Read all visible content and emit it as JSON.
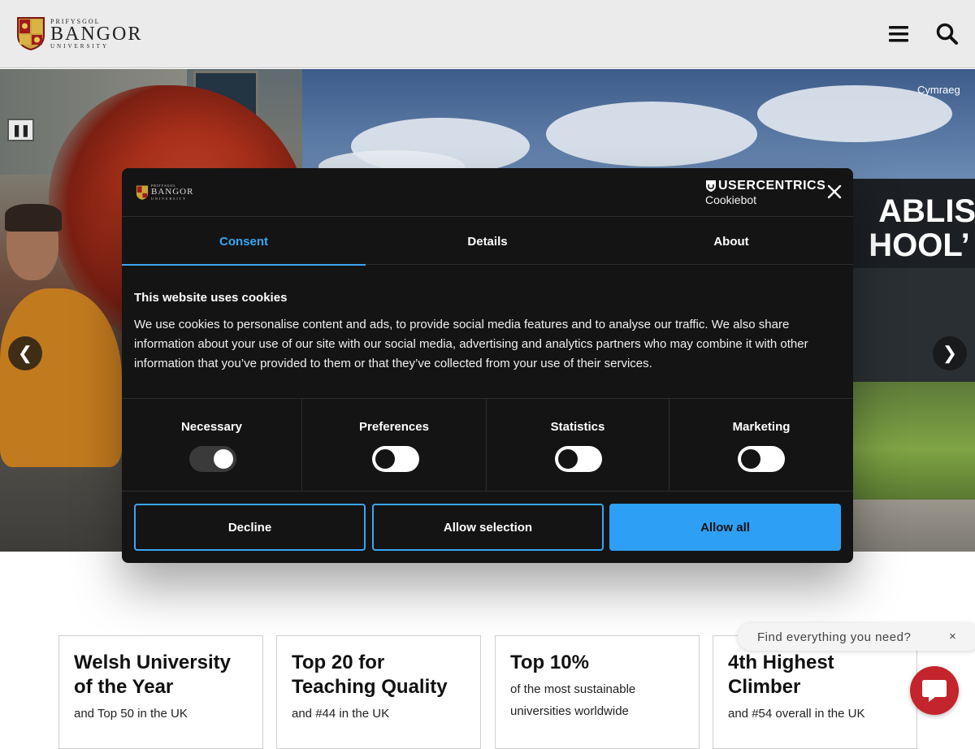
{
  "header": {
    "logo": {
      "top": "PRIFYSGOL",
      "main": "BANGOR",
      "bottom": "UNIVERSITY"
    },
    "menu_icon": "hamburger-icon",
    "search_icon": "search-icon"
  },
  "hero": {
    "language_link": "Cymraeg",
    "banner_line1": "ABLISH",
    "banner_line2": "HOOL’ A",
    "pause_icon": "pause-icon",
    "prev_arrow": "❮",
    "next_arrow": "❯"
  },
  "cookie_dialog": {
    "brand": {
      "name": "USERCENTRICS",
      "sub": "Cookiebot"
    },
    "tabs": [
      {
        "label": "Consent",
        "active": true
      },
      {
        "label": "Details",
        "active": false
      },
      {
        "label": "About",
        "active": false
      }
    ],
    "title": "This website uses cookies",
    "body": "We use cookies to personalise content and ads, to provide social media features and to analyse our traffic. We also share information about your use of our site with our social media, advertising and analytics partners who may combine it with other information that you’ve provided to them or that they’ve collected from your use of their services.",
    "toggles": [
      {
        "label": "Necessary",
        "state": "on"
      },
      {
        "label": "Preferences",
        "state": "off"
      },
      {
        "label": "Statistics",
        "state": "off"
      },
      {
        "label": "Marketing",
        "state": "off"
      }
    ],
    "buttons": {
      "decline": "Decline",
      "allow_selection": "Allow selection",
      "allow_all": "Allow all"
    },
    "colors": {
      "accent": "#3aa6f4",
      "background": "#141414"
    }
  },
  "cards": [
    {
      "title": "Welsh University of the Year",
      "sub": "and Top 50 in the UK"
    },
    {
      "title": "Top 20 for Teaching Quality",
      "sub": "and #44 in the UK"
    },
    {
      "title": "Top 10%",
      "sub": "of the most sustainable universities worldwide"
    },
    {
      "title": "4th Highest Climber",
      "sub": "and #54 overall in the UK"
    }
  ],
  "help": {
    "find_text": "Find everything you need?",
    "close": "×",
    "chat_icon": "chat-bubble-icon",
    "chat_color": "#c4252c"
  }
}
